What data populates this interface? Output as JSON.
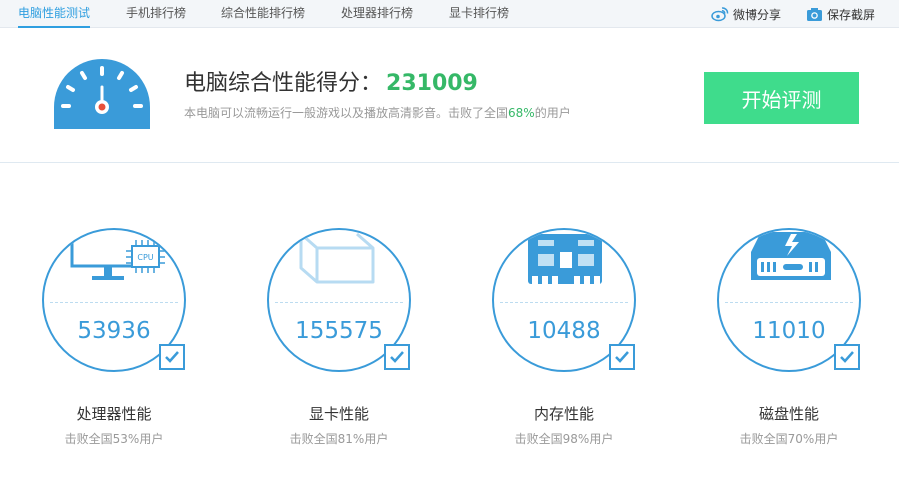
{
  "nav": {
    "tabs": [
      "电脑性能测试",
      "手机排行榜",
      "综合性能排行榜",
      "处理器排行榜",
      "显卡排行榜"
    ],
    "active_index": 0,
    "weibo_label": "微博分享",
    "screenshot_label": "保存截屏"
  },
  "summary": {
    "title": "电脑综合性能得分：",
    "score": "231009",
    "desc_prefix": "本电脑可以流畅运行一般游戏以及播放高清影音。击败了全国",
    "desc_pct": "68%",
    "desc_suffix": "的用户",
    "start_label": "开始评测"
  },
  "cards": [
    {
      "name": "处理器性能",
      "score": "53936",
      "sub": "击败全国53%用户",
      "icon": "cpu-monitor-icon"
    },
    {
      "name": "显卡性能",
      "score": "155575",
      "sub": "击败全国81%用户",
      "icon": "gpu-cube-icon"
    },
    {
      "name": "内存性能",
      "score": "10488",
      "sub": "击败全国98%用户",
      "icon": "memory-chip-icon"
    },
    {
      "name": "磁盘性能",
      "score": "11010",
      "sub": "击败全国70%用户",
      "icon": "disk-drive-icon"
    }
  ],
  "cpu_chip_text": "CPU",
  "colors": {
    "accent": "#3a9bd9",
    "green": "#35b867",
    "button": "#3fdc8c"
  }
}
